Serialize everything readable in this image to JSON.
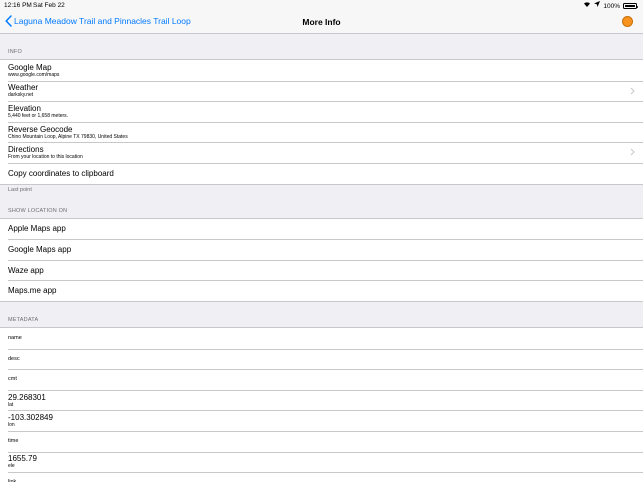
{
  "status": {
    "time": "12:16 PM",
    "date": "Sat Feb 22",
    "battery": "100%"
  },
  "nav": {
    "back_label": "Laguna Meadow Trail and Pinnacles Trail Loop",
    "title": "More Info"
  },
  "info": {
    "header": "INFO",
    "items": [
      {
        "title": "Google Map",
        "sub": "www.google.com/maps",
        "chevron": false
      },
      {
        "title": "Weather",
        "sub": "darksky.net",
        "chevron": true
      },
      {
        "title": "Elevation",
        "sub": "5,440 feet or 1,658 meters.",
        "chevron": false
      },
      {
        "title": "Reverse Geocode",
        "sub": "Chino Mountain Loop, Alpine TX 79830, United States",
        "chevron": false
      },
      {
        "title": "Directions",
        "sub": "From your location to this location",
        "chevron": true
      },
      {
        "title": "Copy coordinates to clipboard"
      }
    ],
    "footer": "Last point"
  },
  "show_location": {
    "header": "SHOW LOCATION ON",
    "items": [
      "Apple Maps app",
      "Google Maps app",
      "Waze app",
      "Maps.me app"
    ]
  },
  "metadata": {
    "header": "METADATA",
    "items": [
      {
        "label": "name",
        "value": ""
      },
      {
        "label": "desc",
        "value": ""
      },
      {
        "label": "cmt",
        "value": ""
      },
      {
        "label": "lat",
        "value": "29.268301"
      },
      {
        "label": "lon",
        "value": "-103.302849"
      },
      {
        "label": "time",
        "value": ""
      },
      {
        "label": "ele",
        "value": "1655.79"
      },
      {
        "label": "link",
        "value": ""
      }
    ]
  }
}
